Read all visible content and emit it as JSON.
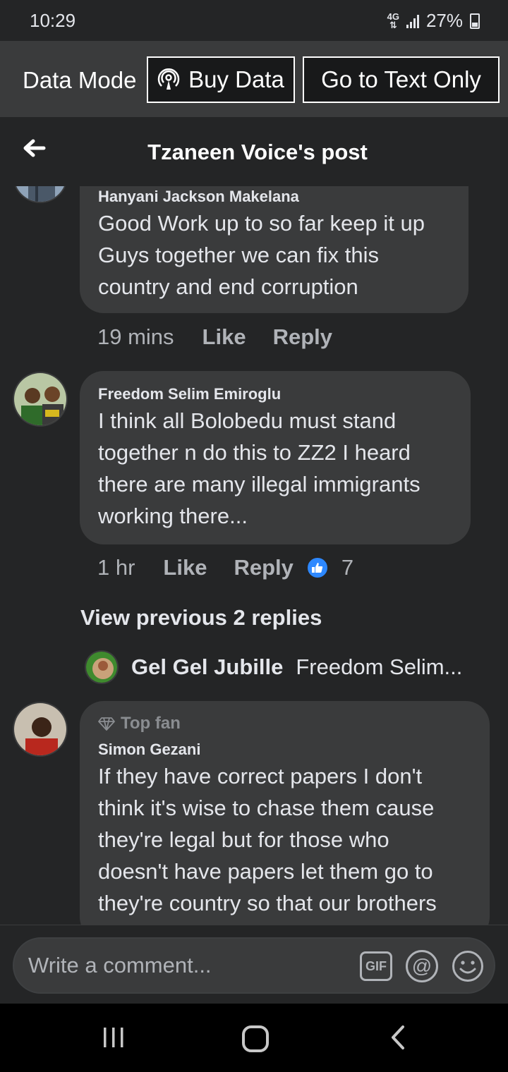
{
  "status_bar": {
    "time": "10:29",
    "network": "4G",
    "battery": "27%"
  },
  "data_bar": {
    "label": "Data Mode",
    "buy_data": "Buy Data",
    "text_only": "Go to Text Only"
  },
  "header": {
    "title": "Tzaneen Voice's post"
  },
  "comments": [
    {
      "author": "Hanyani Jackson Makelana",
      "text_lines": [
        "Good Work up to so far keep it up",
        "Guys together we can fix this",
        "country and end corruption"
      ],
      "time": "19 mins",
      "like": "Like",
      "reply": "Reply"
    },
    {
      "author": "Freedom Selim Emiroglu",
      "text_lines": [
        "I think all Bolobedu must stand",
        "together n do this to ZZ2 I heard",
        "there are many illegal immigrants",
        "working there..."
      ],
      "time": "1 hr",
      "like": "Like",
      "reply": "Reply",
      "reaction_count": "7"
    },
    {
      "badge": "Top fan",
      "author": "Simon Gezani",
      "text_lines": [
        "If they have correct papers I don't",
        "think it's wise to chase them cause",
        "they're legal but for those who",
        "doesn't have papers let them go to",
        "they're country so that our brothers"
      ]
    }
  ],
  "view_previous": "View previous 2 replies",
  "reply_preview": {
    "author": "Gel Gel Jubille",
    "text": "Freedom Selim..."
  },
  "composer": {
    "placeholder": "Write a comment...",
    "gif": "GIF",
    "mention": "@"
  },
  "colors": {
    "background": "#242526",
    "bubble": "#3a3b3c",
    "text": "#e4e6eb",
    "muted": "#b0b3b8",
    "like_blue": "#2d88ff"
  }
}
